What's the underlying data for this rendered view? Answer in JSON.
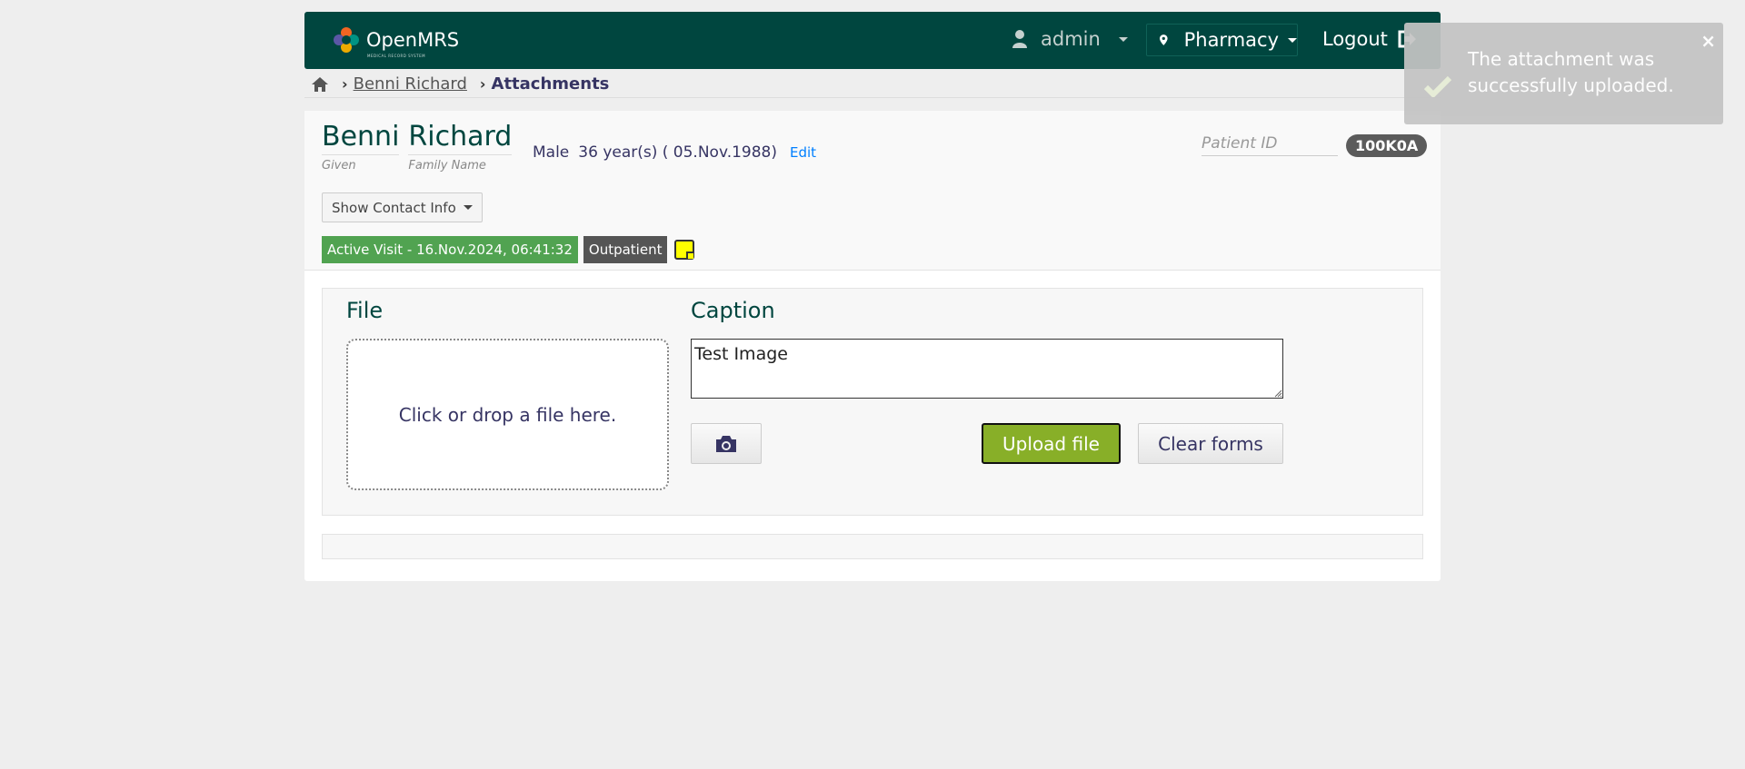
{
  "header": {
    "logo_text": "OpenMRS",
    "logo_subtitle": "MEDICAL RECORD SYSTEM",
    "user_label": "admin",
    "location_label": "Pharmacy",
    "logout_label": "Logout"
  },
  "breadcrumb": {
    "patient": "Benni Richard",
    "current": "Attachments"
  },
  "patient": {
    "given_name": "Benni",
    "family_name": "Richard",
    "given_label": "Given",
    "family_label": "Family Name",
    "gender": "Male",
    "age": "36 year(s) ( 05.Nov.1988)",
    "edit_label": "Edit",
    "patient_id_label": "Patient ID",
    "patient_id": "100K0A",
    "contact_button": "Show Contact Info",
    "visit_badge": "Active Visit - 16.Nov.2024, 06:41:32",
    "visit_type": "Outpatient"
  },
  "upload": {
    "file_label": "File",
    "dropzone_text": "Click or drop a file here.",
    "caption_label": "Caption",
    "caption_value": "Test Image",
    "upload_button": "Upload file",
    "clear_button": "Clear forms"
  },
  "toast": {
    "message": "The attachment was successfully uploaded.",
    "close": "×"
  },
  "colors": {
    "header_bg": "#00463f",
    "visit_green": "#51a351",
    "upload_green": "#88af28",
    "link_blue": "#007fff"
  }
}
